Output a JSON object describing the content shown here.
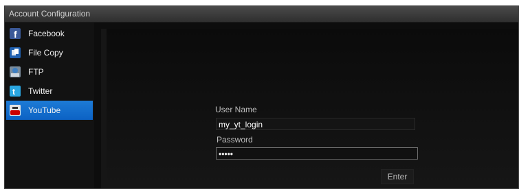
{
  "window": {
    "title": "Account Configuration"
  },
  "sidebar": {
    "items": [
      {
        "label": "Facebook",
        "icon": "facebook-icon"
      },
      {
        "label": "File Copy",
        "icon": "file-copy-icon"
      },
      {
        "label": "FTP",
        "icon": "ftp-icon"
      },
      {
        "label": "Twitter",
        "icon": "twitter-icon"
      },
      {
        "label": "YouTube",
        "icon": "youtube-icon",
        "selected": true
      }
    ]
  },
  "form": {
    "username_label": "User Name",
    "username_value": "my_yt_login",
    "password_label": "Password",
    "password_value": "•••••",
    "enter_label": "Enter"
  },
  "colors": {
    "accent": "#1b78d6",
    "background": "#0d0d0d"
  }
}
